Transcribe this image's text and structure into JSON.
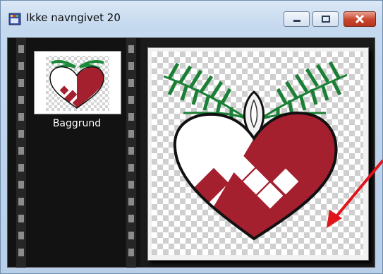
{
  "window": {
    "title": "Ikke navngivet 20",
    "icons": [
      "app-icon",
      "minimize-icon",
      "maximize-icon",
      "close-icon"
    ]
  },
  "layers": {
    "items": [
      {
        "label": "Baggrund"
      }
    ]
  },
  "colors": {
    "heart_red": "#a4202f",
    "leaf_green": "#1b8a3a",
    "arrow_red": "#e0141b"
  }
}
